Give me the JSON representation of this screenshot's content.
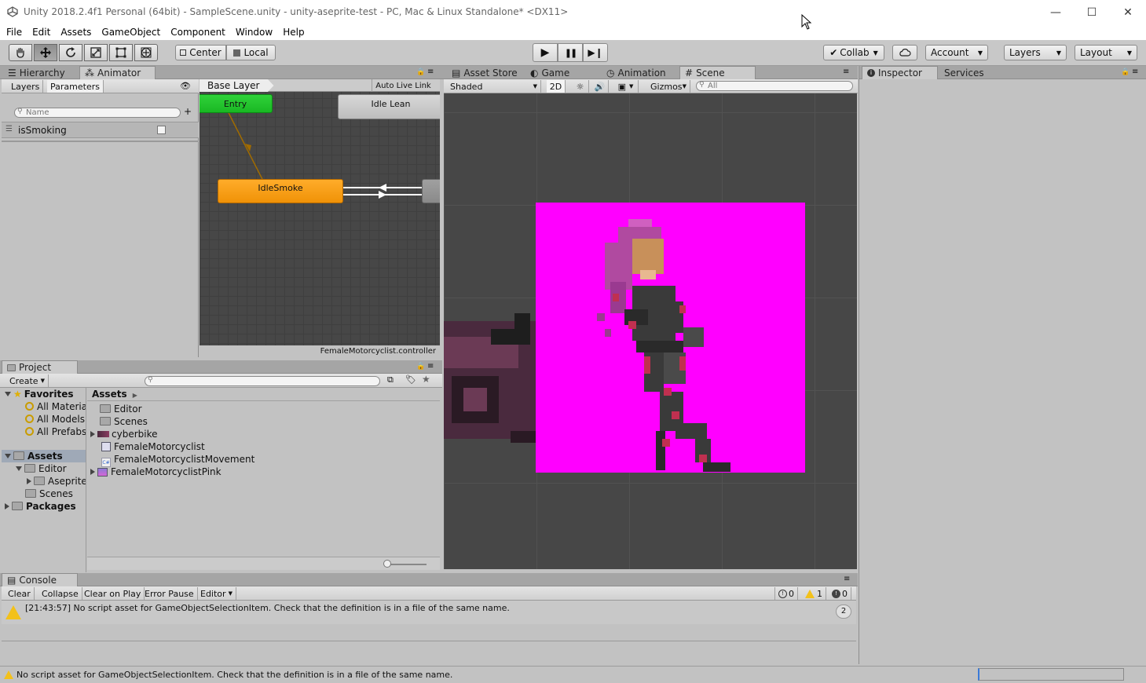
{
  "window": {
    "title": "Unity 2018.2.4f1 Personal (64bit) - SampleScene.unity - unity-aseprite-test - PC, Mac & Linux Standalone* <DX11>",
    "minimize_glyph": "—",
    "maximize_glyph": "☐",
    "close_glyph": "✕"
  },
  "menu": [
    "File",
    "Edit",
    "Assets",
    "GameObject",
    "Component",
    "Window",
    "Help"
  ],
  "toolbar": {
    "pivot": "Center",
    "space": "Local",
    "collab": "Collab",
    "account": "Account",
    "layers": "Layers",
    "layout": "Layout",
    "play_glyph": "▶",
    "pause_glyph": "❚❚",
    "step_glyph": "▶❙"
  },
  "left_tabs": {
    "hierarchy": "Hierarchy",
    "animator": "Animator"
  },
  "animator": {
    "subtabs": {
      "layers": "Layers",
      "parameters": "Parameters"
    },
    "search_placeholder": "Name",
    "parameter": "isSmoking",
    "breadcrumb": "Base Layer",
    "auto_live_link": "Auto Live Link",
    "nodes": {
      "entry": "Entry",
      "idle_lean": "Idle Lean",
      "idle_smoke": "IdleSmoke"
    },
    "controller": "FemaleMotorcyclist.controller"
  },
  "scene_tabs": {
    "asset_store": "Asset Store",
    "game": "Game",
    "animation": "Animation",
    "scene": "Scene"
  },
  "scene_bar": {
    "shaded": "Shaded",
    "mode_2d": "2D",
    "gizmos": "Gizmos",
    "search_placeholder": "All"
  },
  "right_tabs": {
    "inspector": "Inspector",
    "services": "Services"
  },
  "project": {
    "tab": "Project",
    "create": "Create",
    "favorites": "Favorites",
    "favorite_items": [
      "All Materia",
      "All Models",
      "All Prefabs"
    ],
    "assets_root": "Assets",
    "editor": "Editor",
    "aseprite": "Aseprite",
    "scenes": "Scenes",
    "packages": "Packages",
    "breadcrumb": "Assets",
    "files": [
      "Editor",
      "Scenes",
      "cyberbike",
      "FemaleMotorcyclist",
      "FemaleMotorcyclistMovement",
      "FemaleMotorcyclistPink"
    ]
  },
  "console": {
    "tab": "Console",
    "buttons": [
      "Clear",
      "Collapse",
      "Clear on Play",
      "Error Pause",
      "Editor"
    ],
    "counts": {
      "errors": "0",
      "warnings": "1",
      "messages": "0"
    },
    "message": "[21:43:57] No script asset for GameObjectSelectionItem. Check that the definition is in a file of the same name.",
    "repeat_count": "2"
  },
  "status_bar": "No script asset for GameObjectSelectionItem. Check that the definition is in a file of the same name.",
  "colors": {
    "entry_node": "#1fc32a",
    "idle_smoke_node": "#f39a0c",
    "sprite_background": "#ff00ff",
    "scene_background": "#474747"
  }
}
